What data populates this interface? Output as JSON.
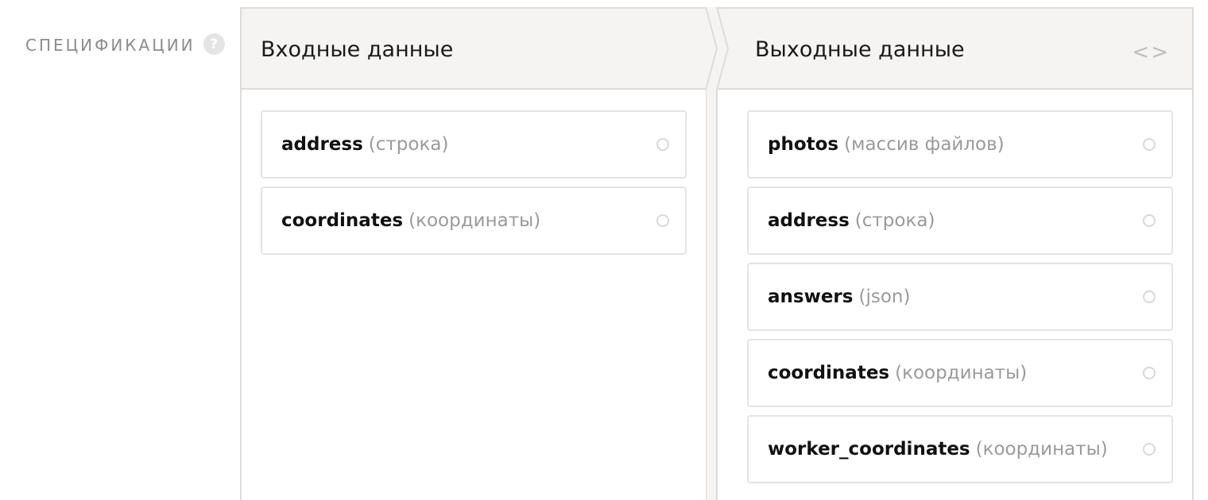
{
  "section": {
    "label": "СПЕЦИФИКАЦИИ",
    "help": "?"
  },
  "input": {
    "title": "Входные данные",
    "fields": [
      {
        "name": "address",
        "type": "(строка)"
      },
      {
        "name": "coordinates",
        "type": "(координаты)"
      }
    ]
  },
  "output": {
    "title": "Выходные данные",
    "code_toggle": "<>",
    "fields": [
      {
        "name": "photos",
        "type": "(массив файлов)"
      },
      {
        "name": "address",
        "type": "(строка)"
      },
      {
        "name": "answers",
        "type": "(json)"
      },
      {
        "name": "coordinates",
        "type": "(координаты)"
      },
      {
        "name": "worker_coordinates",
        "type": "(координаты)"
      }
    ]
  },
  "colors": {
    "header_bg": "#f5f4f2",
    "border": "#dcdcdc",
    "muted": "#9a9a9a"
  }
}
